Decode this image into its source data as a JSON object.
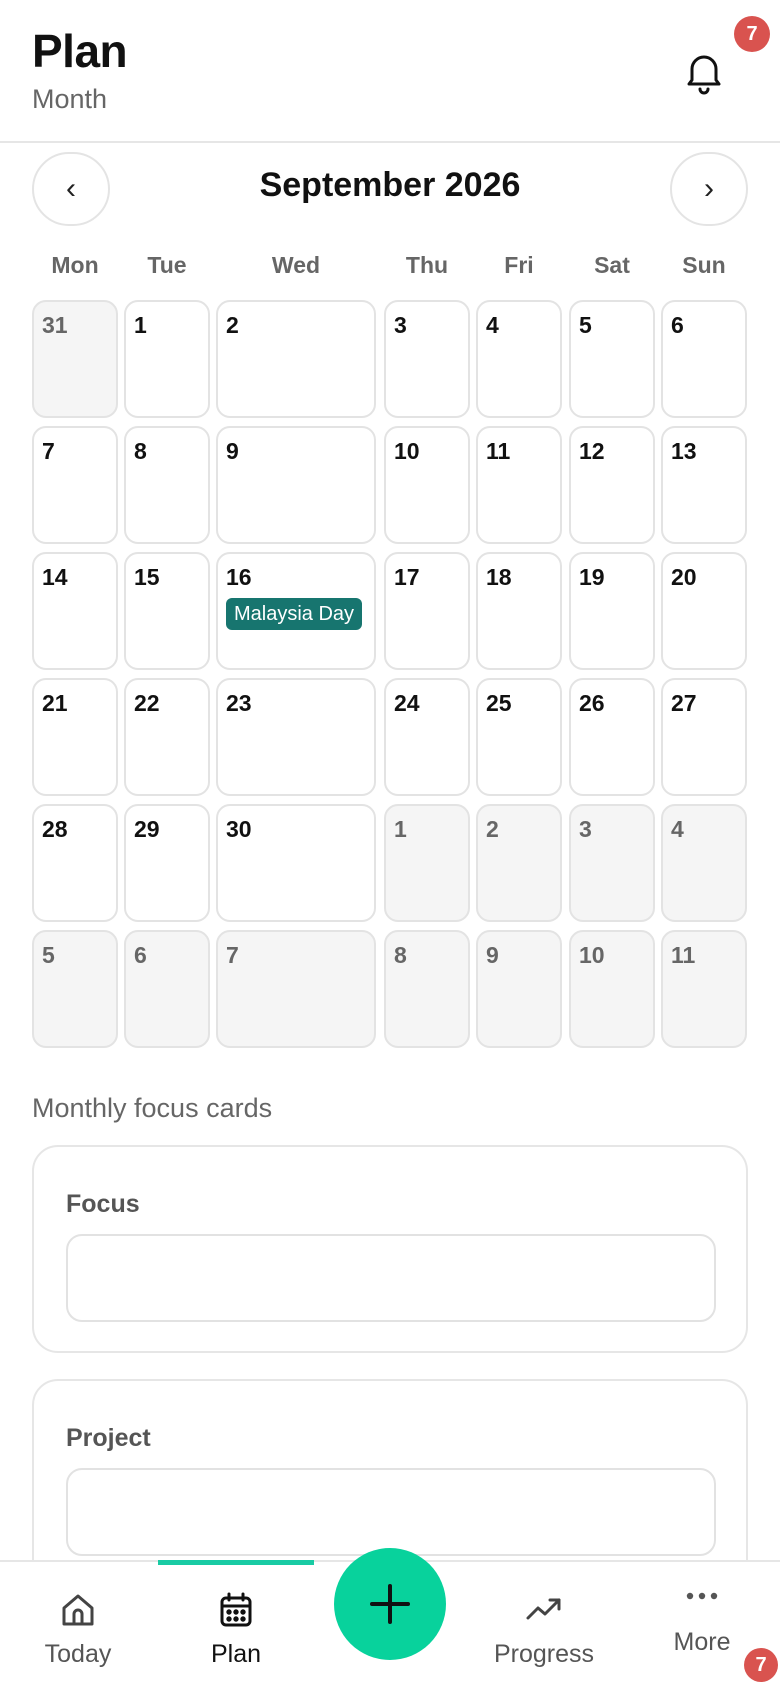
{
  "header": {
    "title": "Plan",
    "subtitle": "Month",
    "notification_count": "7",
    "bell_icon": "bell-icon"
  },
  "calendar": {
    "month_label": "September 2026",
    "prev_icon": "‹",
    "next_icon": "›",
    "weekdays": [
      "Mon",
      "Tue",
      "Wed",
      "Thu",
      "Fri",
      "Sat",
      "Sun"
    ],
    "weeks": [
      [
        {
          "day": "31",
          "outside": true
        },
        {
          "day": "1"
        },
        {
          "day": "2"
        },
        {
          "day": "3"
        },
        {
          "day": "4"
        },
        {
          "day": "5"
        },
        {
          "day": "6"
        }
      ],
      [
        {
          "day": "7"
        },
        {
          "day": "8"
        },
        {
          "day": "9"
        },
        {
          "day": "10"
        },
        {
          "day": "11"
        },
        {
          "day": "12"
        },
        {
          "day": "13"
        }
      ],
      [
        {
          "day": "14"
        },
        {
          "day": "15"
        },
        {
          "day": "16",
          "event": "Malaysia Day"
        },
        {
          "day": "17"
        },
        {
          "day": "18"
        },
        {
          "day": "19"
        },
        {
          "day": "20"
        }
      ],
      [
        {
          "day": "21"
        },
        {
          "day": "22"
        },
        {
          "day": "23"
        },
        {
          "day": "24"
        },
        {
          "day": "25"
        },
        {
          "day": "26"
        },
        {
          "day": "27"
        }
      ],
      [
        {
          "day": "28"
        },
        {
          "day": "29"
        },
        {
          "day": "30"
        },
        {
          "day": "1",
          "outside": true
        },
        {
          "day": "2",
          "outside": true
        },
        {
          "day": "3",
          "outside": true
        },
        {
          "day": "4",
          "outside": true
        }
      ],
      [
        {
          "day": "5",
          "outside": true
        },
        {
          "day": "6",
          "outside": true
        },
        {
          "day": "7",
          "outside": true
        },
        {
          "day": "8",
          "outside": true
        },
        {
          "day": "9",
          "outside": true
        },
        {
          "day": "10",
          "outside": true
        },
        {
          "day": "11",
          "outside": true
        }
      ]
    ],
    "holiday_color": "#17756f"
  },
  "focus_section": {
    "title": "Monthly focus cards",
    "cards": [
      {
        "label": "Focus",
        "value": ""
      },
      {
        "label": "Project",
        "value": ""
      }
    ]
  },
  "tabbar": {
    "tabs": [
      {
        "label": "Today",
        "icon": "home-icon"
      },
      {
        "label": "Plan",
        "icon": "calendar-icon",
        "active": true
      },
      {
        "label": "Progress",
        "icon": "trending-up-icon"
      },
      {
        "label": "More",
        "icon": "more-dots-icon",
        "badge": "7"
      }
    ],
    "fab_icon": "plus-icon",
    "accent_color": "#08d29c"
  }
}
